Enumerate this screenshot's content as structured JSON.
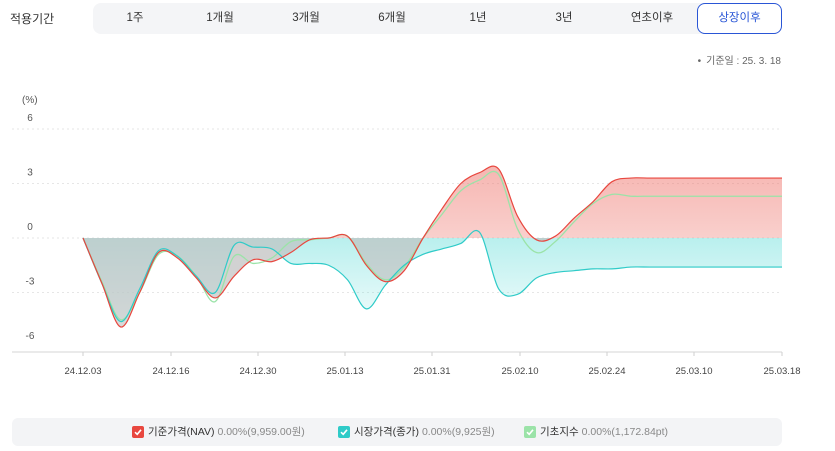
{
  "header": {
    "period_label": "적용기간",
    "tabs": [
      {
        "label": "1주",
        "active": false
      },
      {
        "label": "1개월",
        "active": false
      },
      {
        "label": "3개월",
        "active": false
      },
      {
        "label": "6개월",
        "active": false
      },
      {
        "label": "1년",
        "active": false
      },
      {
        "label": "3년",
        "active": false
      },
      {
        "label": "연초이후",
        "active": false
      },
      {
        "label": "상장이후",
        "active": true
      }
    ],
    "base_date": "기준일 : 25. 3. 18"
  },
  "legend": [
    {
      "name": "기준가격(NAV)",
      "value": "0.00%(9,959.00원)",
      "color": "#e8473f",
      "icon": "check-icon"
    },
    {
      "name": "시장가격(종가)",
      "value": "0.00%(9,925원)",
      "color": "#2fcbc8",
      "icon": "check-icon"
    },
    {
      "name": "기초지수",
      "value": "0.00%(1,172.84pt)",
      "color": "#9be3a8",
      "icon": "check-icon"
    }
  ],
  "chart_data": {
    "type": "area",
    "ylabel": "(%)",
    "ylim": [
      -6,
      6
    ],
    "yticks": [
      6,
      3,
      0,
      -3,
      -6
    ],
    "xticks": [
      "24.12.03",
      "24.12.16",
      "24.12.30",
      "25.01.13",
      "25.01.31",
      "25.02.10",
      "25.02.24",
      "25.03.10",
      "25.03.18"
    ],
    "grid": true,
    "colors": {
      "nav": "#e8473f",
      "market": "#2fcbc8",
      "index": "#9be3a8"
    },
    "x": [
      "24.12.03",
      "24.12.05",
      "24.12.09",
      "24.12.11",
      "24.12.13",
      "24.12.16",
      "24.12.18",
      "24.12.20",
      "24.12.24",
      "24.12.27",
      "24.12.30",
      "24.12.31",
      "25.01.03",
      "25.01.07",
      "25.01.09",
      "25.01.13",
      "25.01.15",
      "25.01.17",
      "25.01.21",
      "25.01.23",
      "25.01.31",
      "25.02.03",
      "25.02.05",
      "25.02.07",
      "25.02.10",
      "25.02.12",
      "25.02.14",
      "25.02.18",
      "25.02.20",
      "25.02.24",
      "25.02.26",
      "25.02.28",
      "25.03.04",
      "25.03.06",
      "25.03.10",
      "25.03.12",
      "25.03.14",
      "25.03.18"
    ],
    "series": [
      {
        "name": "기준가격(NAV)",
        "key": "nav",
        "values": [
          0,
          -2.5,
          -4.9,
          -3.0,
          -0.8,
          -1.1,
          -2.2,
          -3.3,
          -2.1,
          -1.2,
          -1.3,
          -0.8,
          -0.1,
          0.0,
          0.1,
          -1.5,
          -2.4,
          -1.8,
          0.0,
          1.6,
          3.0,
          3.6,
          3.8,
          1.2,
          -0.1,
          0.1,
          1.1,
          2.0,
          3.1,
          3.3,
          3.3,
          3.3,
          3.3,
          3.3,
          3.3,
          3.3,
          3.3,
          3.3
        ]
      },
      {
        "name": "시장가격(종가)",
        "key": "market",
        "values": [
          0,
          -2.5,
          -4.6,
          -2.8,
          -0.7,
          -1.0,
          -2.1,
          -3.0,
          -0.4,
          -0.5,
          -0.6,
          -1.4,
          -1.4,
          -1.5,
          -2.3,
          -3.9,
          -2.6,
          -1.5,
          -0.9,
          -0.6,
          -0.3,
          0.3,
          -2.8,
          -3.1,
          -2.2,
          -1.9,
          -1.8,
          -1.7,
          -1.7,
          -1.6,
          -1.6,
          -1.6,
          -1.6,
          -1.6,
          -1.6,
          -1.6,
          -1.6,
          -1.6
        ]
      },
      {
        "name": "기초지수",
        "key": "index",
        "values": [
          0,
          -2.4,
          -4.5,
          -3.0,
          -0.9,
          -1.0,
          -2.1,
          -3.5,
          -1.0,
          -1.4,
          -1.1,
          -0.2,
          -0.1,
          0.0,
          0.1,
          -1.4,
          -2.3,
          -1.6,
          0.0,
          1.3,
          2.6,
          3.2,
          3.5,
          0.5,
          -0.8,
          -0.2,
          0.9,
          1.9,
          2.4,
          2.3,
          2.3,
          2.3,
          2.3,
          2.3,
          2.3,
          2.3,
          2.3,
          2.3
        ]
      }
    ]
  }
}
